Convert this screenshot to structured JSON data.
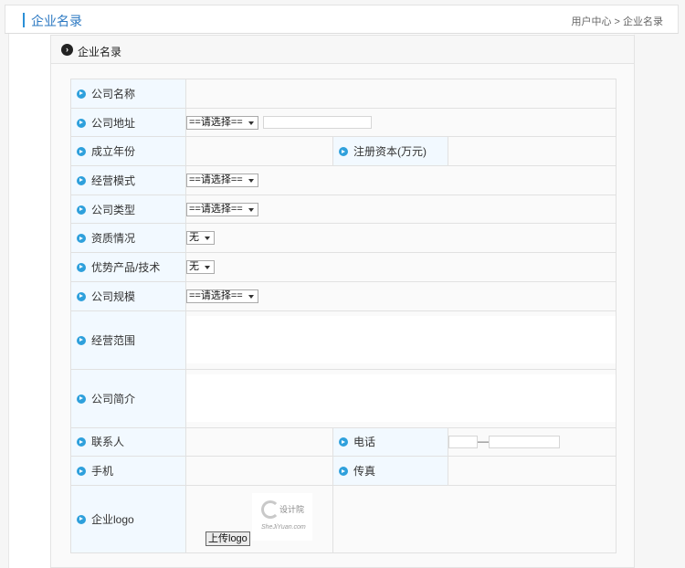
{
  "header": {
    "title": "企业名录",
    "breadcrumb": "用户中心 > 企业名录"
  },
  "panel": {
    "title": "企业名录"
  },
  "form": {
    "company_name": "公司名称",
    "company_address": "公司地址",
    "address_select": "==请选择==",
    "founded_year": "成立年份",
    "registered_capital": "注册资本(万元)",
    "business_model": "经营模式",
    "business_model_select": "==请选择==",
    "company_type": "公司类型",
    "company_type_select": "==请选择==",
    "qualification": "资质情况",
    "qualification_select": "无",
    "advantage": "优势产品/技术",
    "advantage_select": "无",
    "company_scale": "公司规模",
    "company_scale_select": "==请选择==",
    "business_scope": "经营范围",
    "company_intro": "公司简介",
    "contact": "联系人",
    "phone": "电话",
    "phone_sep": "—",
    "mobile": "手机",
    "fax": "传真",
    "logo": "企业logo",
    "upload_label": "上传logo",
    "logo_text": "设计院",
    "logo_sub": "SheJiYuan.com"
  }
}
